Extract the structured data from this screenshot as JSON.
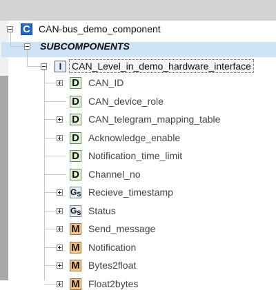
{
  "tree": {
    "root": {
      "icon": "C",
      "label": "CAN-bus_demo_component"
    },
    "group": {
      "label": "SUBCOMPONENTS"
    },
    "interface": {
      "icon": "I",
      "label": "CAN_Level_in_demo_hardware_interface"
    },
    "items": [
      {
        "icon": "D",
        "icon_name": "data-icon",
        "label": "CAN_ID",
        "expandable": true
      },
      {
        "icon": "D",
        "icon_name": "data-icon",
        "label": "CAN_device_role",
        "expandable": false
      },
      {
        "icon": "D",
        "icon_name": "data-icon",
        "label": "CAN_telegram_mapping_table",
        "expandable": true
      },
      {
        "icon": "D",
        "icon_name": "data-icon",
        "label": "Acknowledge_enable",
        "expandable": true
      },
      {
        "icon": "D",
        "icon_name": "data-icon",
        "label": "Notification_time_limit",
        "expandable": false
      },
      {
        "icon": "D",
        "icon_name": "data-icon",
        "label": "Channel_no",
        "expandable": false
      },
      {
        "icon": "GS",
        "icon_name": "getter-setter-icon",
        "label": "Recieve_timestamp",
        "expandable": true
      },
      {
        "icon": "GS",
        "icon_name": "getter-setter-icon",
        "label": "Status",
        "expandable": true
      },
      {
        "icon": "M",
        "icon_name": "method-icon",
        "label": "Send_message",
        "expandable": true
      },
      {
        "icon": "M",
        "icon_name": "method-icon",
        "label": "Notification",
        "expandable": true
      },
      {
        "icon": "M",
        "icon_name": "method-icon",
        "label": "Bytes2float",
        "expandable": true
      },
      {
        "icon": "M",
        "icon_name": "method-icon",
        "label": "Float2bytes",
        "expandable": true
      }
    ]
  },
  "colors": {
    "selection": "#cfe3f7",
    "component_badge": "#2066c8",
    "data_badge": "#dff5d5",
    "method_badge": "#f9c287",
    "tree_lines": "#c6c6c6"
  }
}
